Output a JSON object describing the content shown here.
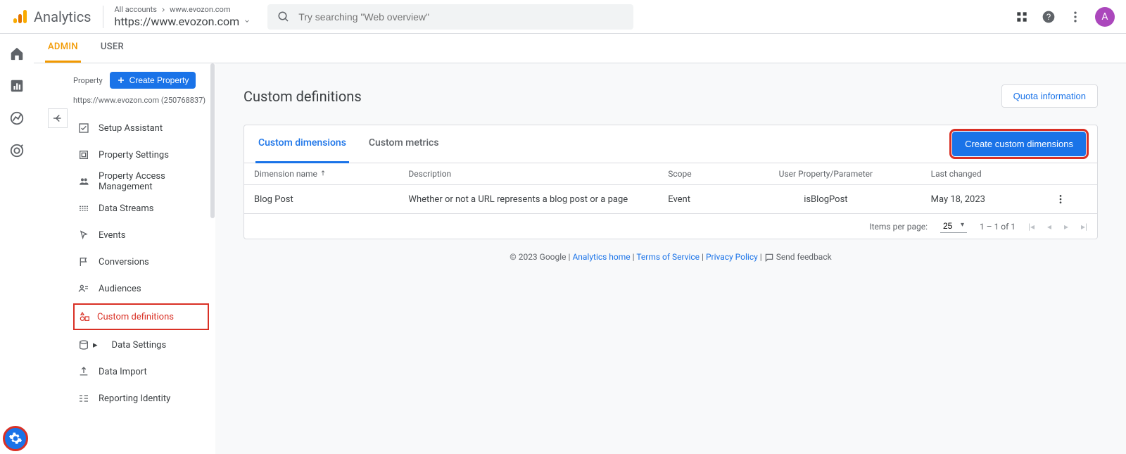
{
  "header": {
    "brand": "Analytics",
    "account_path_prefix": "All accounts",
    "account_name": "www.evozon.com",
    "property": "https://www.evozon.com",
    "search_placeholder": "Try searching \"Web overview\"",
    "avatar_letter": "A"
  },
  "tabs": {
    "admin": "ADMIN",
    "user": "USER"
  },
  "sidebar": {
    "section_label": "Property",
    "create_label": "Create Property",
    "property_line": "https://www.evozon.com (250768837)",
    "items": [
      {
        "label": "Setup Assistant"
      },
      {
        "label": "Property Settings"
      },
      {
        "label": "Property Access Management"
      },
      {
        "label": "Data Streams"
      },
      {
        "label": "Events"
      },
      {
        "label": "Conversions"
      },
      {
        "label": "Audiences"
      },
      {
        "label": "Custom definitions"
      },
      {
        "label": "Data Settings"
      },
      {
        "label": "Data Import"
      },
      {
        "label": "Reporting Identity"
      }
    ]
  },
  "main": {
    "title": "Custom definitions",
    "quota_btn": "Quota information",
    "card_tabs": {
      "dimensions": "Custom dimensions",
      "metrics": "Custom metrics"
    },
    "create_btn": "Create custom dimensions",
    "columns": {
      "name": "Dimension name",
      "desc": "Description",
      "scope": "Scope",
      "param": "User Property/Parameter",
      "changed": "Last changed"
    },
    "rows": [
      {
        "name": "Blog Post",
        "desc": "Whether or not a URL represents a blog post or a page",
        "scope": "Event",
        "param": "isBlogPost",
        "changed": "May 18, 2023"
      }
    ],
    "paginator": {
      "label": "Items per page:",
      "size": "25",
      "range": "1 – 1 of 1"
    }
  },
  "footer": {
    "copyright": "© 2023 Google",
    "links": {
      "home": "Analytics home",
      "tos": "Terms of Service",
      "priv": "Privacy Policy"
    },
    "feedback": "Send feedback"
  }
}
